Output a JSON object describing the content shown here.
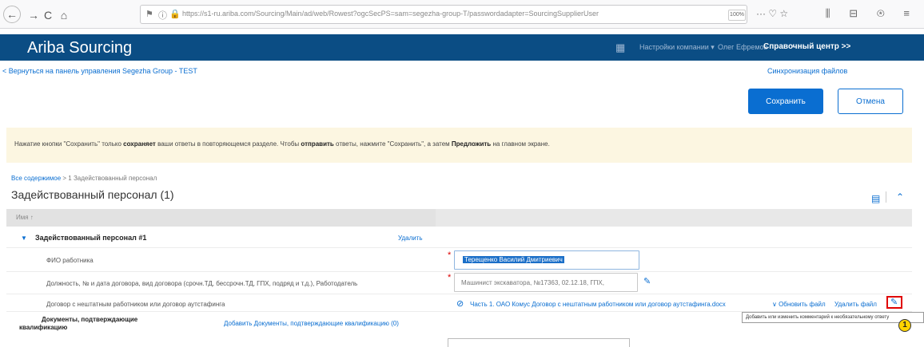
{
  "browser": {
    "back": "←",
    "forward": "→",
    "reload": "C",
    "home": "⌂",
    "url": "https://s1-ru.ariba.com/Sourcing/Main/ad/web/Rowest?ogcSecPS=sam=segezha-group-T/passwordadapter=SourcingSupplierUser",
    "zoom": "100%",
    "more": "··· ♡ ☆",
    "toolbar_right": "⫼ ⊟ ⊛ ≡"
  },
  "app": {
    "brand": "Ariba Sourcing",
    "settings_link": "Настройки компании ▾",
    "user_link": "Олег Ефремов",
    "help_link": "Справочный центр >>"
  },
  "subheader": {
    "back_link": "< Вернуться на панель управления Segezha Group - TEST",
    "sync_link": "Синхронизация файлов",
    "save_button": "Сохранить",
    "cancel_button": "Отмена"
  },
  "banner": {
    "part1": "Нажатие кнопки \"Сохранить\" только ",
    "bold1": "сохраняет",
    "part2": " ваши ответы в повторяющемся разделе. Чтобы ",
    "bold2": "отправить",
    "part3": " ответы, нажмите \"Сохранить\", а затем ",
    "bold3": "Предложить",
    "part4": " на главном экране."
  },
  "breadcrumb": {
    "root": "Все содержимое",
    "separator": " > ",
    "current": "1 Задействованный персонал"
  },
  "section": {
    "title": "Задействованный персонал (1)",
    "column_header": "Имя ↑"
  },
  "rows": {
    "group_title": "Задействованный персонал #1",
    "group_delete": "Удалить",
    "fio_label": "ФИО работника",
    "fio_value": "Терещенко Василий Дмитриевич",
    "contract_label": "Должность, № и дата договора, вид договора (срочн.ТД, бессрочн.ТД, ГПХ, подряд и т.д.), Работодатель",
    "contract_value": "Машинист экскаватора, №17363, 02.12.18, ГПХ,",
    "outsource_label": "Договор с нештатным работником или договор аутстафинга",
    "outsource_file": "Часть 1. ОАО Комус Договор с нештатным работником или договор аутстафинга.docx",
    "update_file": "∨ Обновить файл",
    "delete_file": "Удалить файл",
    "docs_label_line1": "Документы, подтверждающие",
    "docs_label_line2": "квалификацию",
    "docs_add_link": "Добавить Документы, подтверждающие квалификацию (0)"
  },
  "tooltip": {
    "text": "Добавить или изменить комментарий к необязательному ответу"
  },
  "badge": {
    "step": "1"
  },
  "colors": {
    "header_bg": "#0b4d84",
    "accent": "#0a6ed1",
    "banner_bg": "#fcf6e1",
    "highlight": "#e00000",
    "badge": "#ffd400"
  }
}
